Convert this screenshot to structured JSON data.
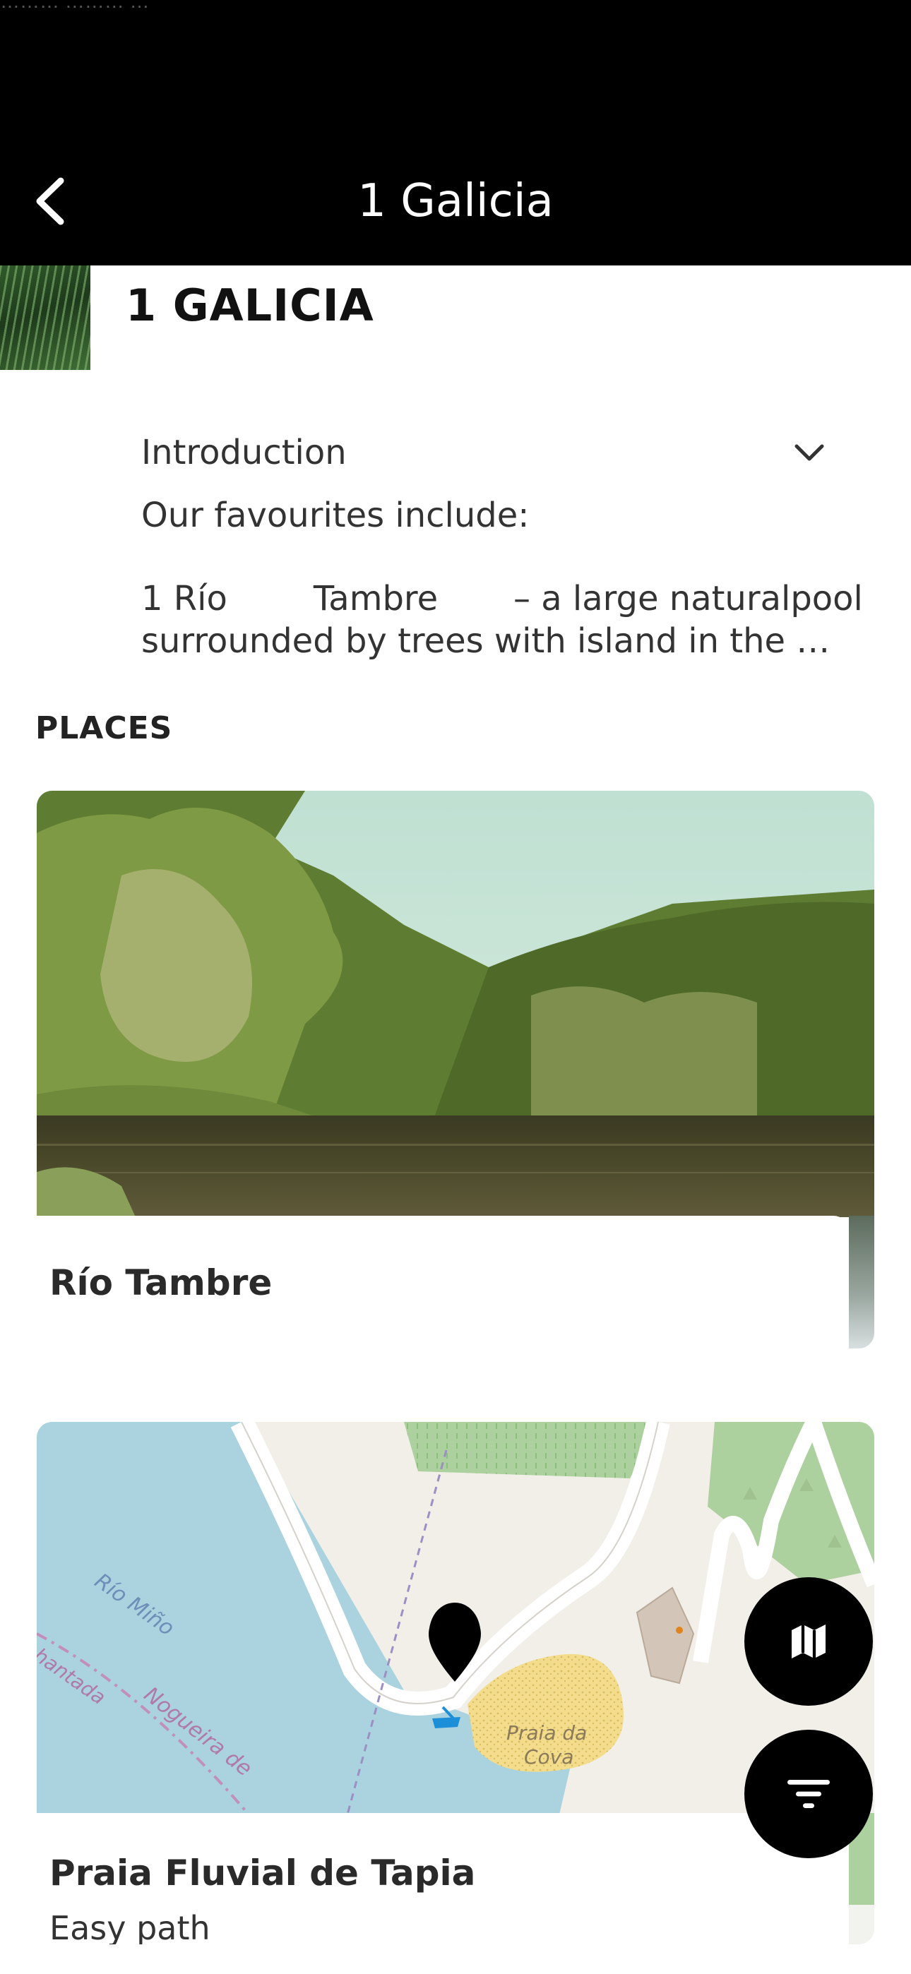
{
  "status_bar": {
    "text": "……… ……… …"
  },
  "nav": {
    "title": "1 Galicia",
    "back_icon": "chevron-left-icon"
  },
  "header": {
    "heading": "1 GALICIA"
  },
  "introduction": {
    "label": "Introduction",
    "expand_icon": "chevron-down-icon",
    "line1": "Our favourites include:",
    "line2": "1 Río        Tambre       – a large naturalpool",
    "line3": "surrounded by trees with island in the …"
  },
  "places": {
    "section_label": "PLACES",
    "items": [
      {
        "title": "Río Tambre",
        "subtitle": ""
      },
      {
        "title": "Praia Fluvial de Tapia",
        "subtitle": "Easy path"
      }
    ]
  },
  "map_labels": {
    "river": "Río Miño",
    "town": "hantada",
    "road": "Nogueira de",
    "beach_line1": "Praia da",
    "beach_line2": "Cova"
  },
  "fabs": {
    "map_icon": "map-icon",
    "filter_icon": "filter-icon"
  },
  "colors": {
    "bar": "#000000",
    "water": "#aad3df",
    "park": "#add19e",
    "sand": "#f3dc8c"
  }
}
